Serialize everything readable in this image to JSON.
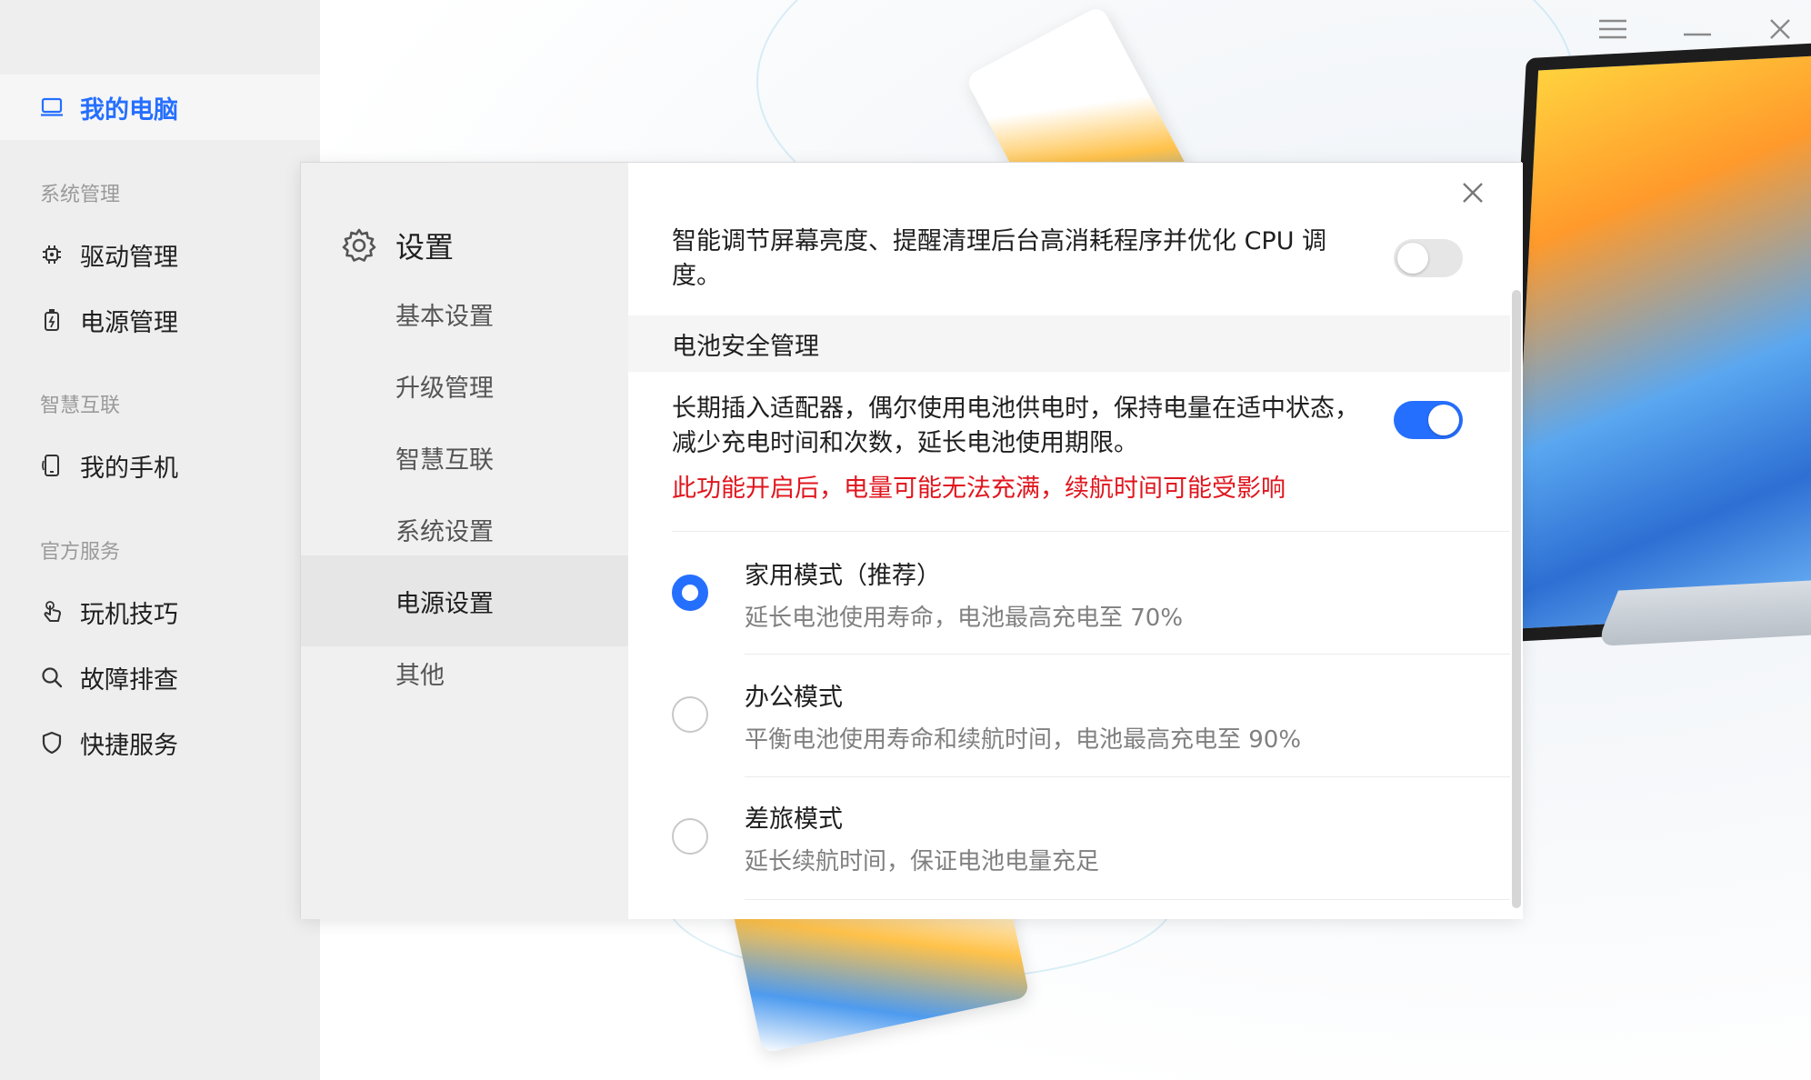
{
  "sidebar": {
    "top_item": {
      "label": "我的电脑",
      "icon": "laptop-icon"
    },
    "groups": [
      {
        "title": "系统管理",
        "items": [
          {
            "label": "驱动管理",
            "icon": "chip-icon"
          },
          {
            "label": "电源管理",
            "icon": "battery-icon"
          }
        ]
      },
      {
        "title": "智慧互联",
        "items": [
          {
            "label": "我的手机",
            "icon": "phone-icon"
          }
        ]
      },
      {
        "title": "官方服务",
        "items": [
          {
            "label": "玩机技巧",
            "icon": "touch-icon"
          },
          {
            "label": "故障排查",
            "icon": "search-icon"
          },
          {
            "label": "快捷服务",
            "icon": "shield-icon"
          }
        ]
      }
    ]
  },
  "colors": {
    "accent": "#256fff",
    "warning": "#e0161e"
  },
  "dialog": {
    "title": "设置",
    "nav": [
      "基本设置",
      "升级管理",
      "智慧互联",
      "系统设置",
      "电源设置",
      "其他"
    ],
    "active_nav": "电源设置",
    "smart_desc": "智能调节屏幕亮度、提醒清理后台高消耗程序并优化 CPU 调度。",
    "smart_toggle": false,
    "battery_section": "电池安全管理",
    "battery_desc": "长期插入适配器，偶尔使用电池供电时，保持电量在适中状态，减少充电时间和次数，延长电池使用期限。",
    "battery_toggle": true,
    "battery_warning": "此功能开启后，电量可能无法充满，续航时间可能受影响",
    "modes": [
      {
        "title": "家用模式（推荐）",
        "desc": "延长电池使用寿命，电池最高充电至 70%",
        "selected": true
      },
      {
        "title": "办公模式",
        "desc": "平衡电池使用寿命和续航时间，电池最高充电至 90%",
        "selected": false
      },
      {
        "title": "差旅模式",
        "desc": "延长续航时间，保证电池电量充足",
        "selected": false
      }
    ]
  }
}
